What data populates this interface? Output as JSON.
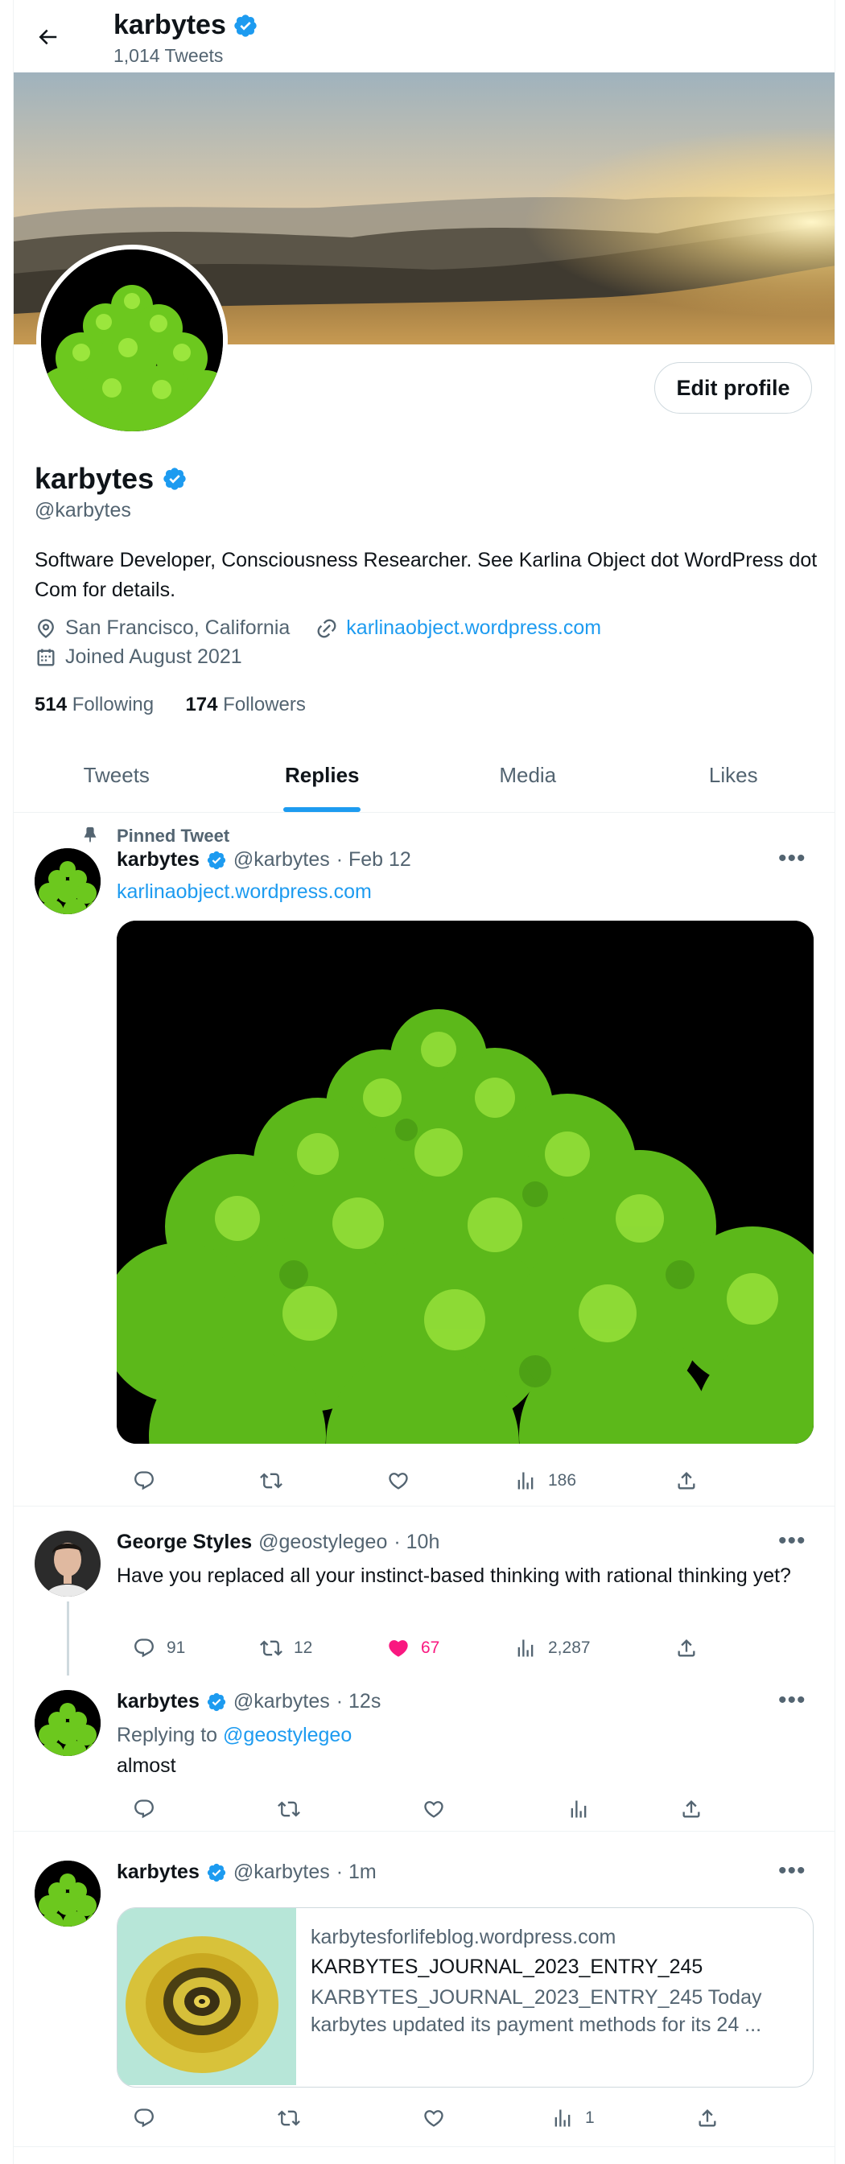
{
  "header": {
    "display_name": "karbytes",
    "tweet_count": "1,014 Tweets"
  },
  "profile": {
    "display_name": "karbytes",
    "handle": "@karbytes",
    "bio": "Software Developer, Consciousness Researcher. See Karlina Object dot WordPress dot Com for details.",
    "location": "San Francisco, California",
    "website": "karlinaobject.wordpress.com",
    "joined": "Joined August 2021",
    "following_count": "514",
    "following_label": "Following",
    "followers_count": "174",
    "followers_label": "Followers",
    "edit_profile_label": "Edit profile"
  },
  "tabs": [
    {
      "label": "Tweets"
    },
    {
      "label": "Replies"
    },
    {
      "label": "Media"
    },
    {
      "label": "Likes"
    }
  ],
  "active_tab": "Replies",
  "tweets": [
    {
      "pinned_label": "Pinned Tweet",
      "name": "karbytes",
      "handle": "@karbytes",
      "time": "· Feb 12",
      "link": "karlinaobject.wordpress.com",
      "views": "186"
    },
    {
      "name": "George Styles",
      "handle": "@geostylegeo",
      "time": "· 10h",
      "text": "Have you replaced all your instinct-based thinking with rational thinking yet?",
      "replies": "91",
      "retweets": "12",
      "likes": "67",
      "views": "2,287"
    },
    {
      "name": "karbytes",
      "handle": "@karbytes",
      "time": "· 12s",
      "replying_to_prefix": "Replying to",
      "replying_to": "@geostylegeo",
      "text": "almost"
    },
    {
      "name": "karbytes",
      "handle": "@karbytes",
      "time": "· 1m",
      "card": {
        "domain": "karbytesforlifeblog.wordpress.com",
        "title": "KARBYTES_JOURNAL_2023_ENTRY_245",
        "description": "KARBYTES_JOURNAL_2023_ENTRY_245 Today karbytes updated its payment methods for its 24 ..."
      },
      "views": "1"
    }
  ],
  "colors": {
    "accent": "#1d9bf0",
    "like": "#f91880",
    "text": "#0f1419",
    "muted": "#536471"
  }
}
